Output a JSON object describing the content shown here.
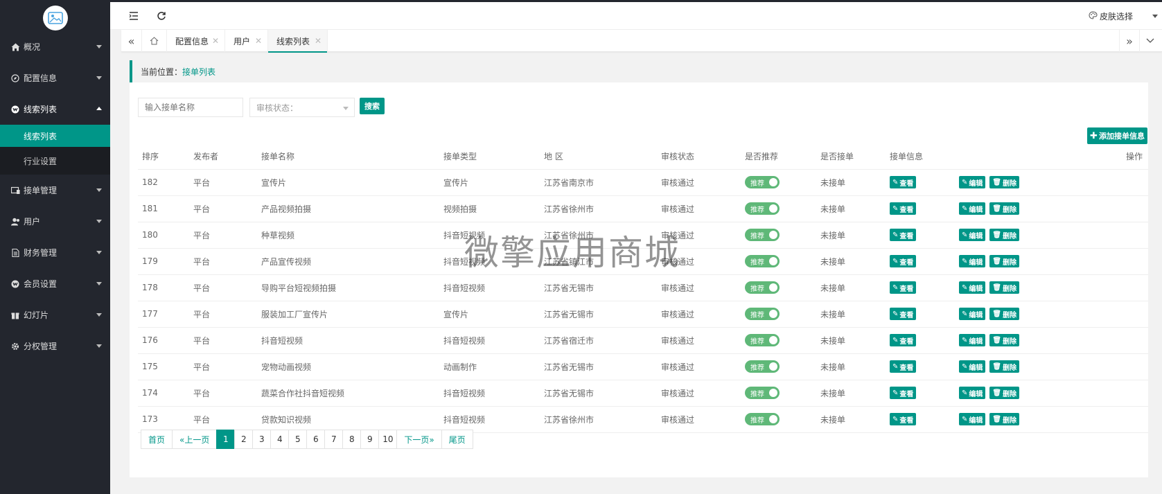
{
  "sidebar": {
    "items": [
      {
        "label": "概况",
        "icon": "home-icon",
        "open": false
      },
      {
        "label": "配置信息",
        "icon": "compass-icon",
        "open": false
      },
      {
        "label": "线索列表",
        "icon": "clue-icon",
        "open": true
      },
      {
        "label": "接单管理",
        "icon": "order-icon",
        "open": false
      },
      {
        "label": "用户",
        "icon": "user-icon",
        "open": false
      },
      {
        "label": "财务管理",
        "icon": "document-icon",
        "open": false
      },
      {
        "label": "会员设置",
        "icon": "vip-icon",
        "open": false
      },
      {
        "label": "幻灯片",
        "icon": "gift-icon",
        "open": false
      },
      {
        "label": "分权管理",
        "icon": "gear-icon",
        "open": false
      }
    ],
    "submenu": [
      {
        "label": "线索列表",
        "active": true
      },
      {
        "label": "行业设置",
        "active": false
      }
    ]
  },
  "header": {
    "skin_label": "皮肤选择"
  },
  "tabs": [
    {
      "label": "配置信息",
      "closable": true
    },
    {
      "label": "用户",
      "closable": true
    },
    {
      "label": "线索列表",
      "closable": true,
      "active": true
    }
  ],
  "breadcrumb": {
    "prefix": "当前位置：",
    "current": "接单列表"
  },
  "filters": {
    "search_placeholder": "输入接单名称",
    "status_placeholder": "审核状态：",
    "search_button": "搜索",
    "add_button": "添加接单信息"
  },
  "table": {
    "headers": [
      "排序",
      "发布者",
      "接单名称",
      "接单类型",
      "地 区",
      "审核状态",
      "是否推荐",
      "是否接单",
      "接单信息",
      "操作"
    ],
    "toggle_label": "推荐",
    "view_label": "查看",
    "edit_label": "编辑",
    "delete_label": "删除",
    "rows": [
      {
        "sort": "182",
        "publisher": "平台",
        "name": "宣传片",
        "type": "宣传片",
        "region": "江苏省南京市",
        "status": "审核通过",
        "taken": "未接单"
      },
      {
        "sort": "181",
        "publisher": "平台",
        "name": "产品视频拍摄",
        "type": "视频拍摄",
        "region": "江苏省徐州市",
        "status": "审核通过",
        "taken": "未接单"
      },
      {
        "sort": "180",
        "publisher": "平台",
        "name": "种草视频",
        "type": "抖音短视频",
        "region": "江苏省徐州市",
        "status": "审核通过",
        "taken": "未接单"
      },
      {
        "sort": "179",
        "publisher": "平台",
        "name": "产品宣传视频",
        "type": "抖音短视频",
        "region": "江苏省镇江市",
        "status": "审核通过",
        "taken": "未接单"
      },
      {
        "sort": "178",
        "publisher": "平台",
        "name": "导购平台短视频拍摄",
        "type": "抖音短视频",
        "region": "江苏省无锡市",
        "status": "审核通过",
        "taken": "未接单"
      },
      {
        "sort": "177",
        "publisher": "平台",
        "name": "服装加工厂宣传片",
        "type": "宣传片",
        "region": "江苏省无锡市",
        "status": "审核通过",
        "taken": "未接单"
      },
      {
        "sort": "176",
        "publisher": "平台",
        "name": "抖音短视频",
        "type": "抖音短视频",
        "region": "江苏省宿迁市",
        "status": "审核通过",
        "taken": "未接单"
      },
      {
        "sort": "175",
        "publisher": "平台",
        "name": "宠物动画视频",
        "type": "动画制作",
        "region": "江苏省无锡市",
        "status": "审核通过",
        "taken": "未接单"
      },
      {
        "sort": "174",
        "publisher": "平台",
        "name": "蔬菜合作社抖音短视频",
        "type": "抖音短视频",
        "region": "江苏省无锡市",
        "status": "审核通过",
        "taken": "未接单"
      },
      {
        "sort": "173",
        "publisher": "平台",
        "name": "贷款知识视频",
        "type": "抖音短视频",
        "region": "江苏省徐州市",
        "status": "审核通过",
        "taken": "未接单"
      }
    ]
  },
  "pagination": {
    "first": "首页",
    "prev": "«上一页",
    "pages": [
      "1",
      "2",
      "3",
      "4",
      "5",
      "6",
      "7",
      "8",
      "9",
      "10"
    ],
    "current": "1",
    "next": "下一页»",
    "last": "尾页"
  },
  "watermark": "微擎应用商城",
  "colors": {
    "sidebar_bg": "#23262e",
    "accent": "#009688",
    "toggle_on": "#5fb878"
  }
}
